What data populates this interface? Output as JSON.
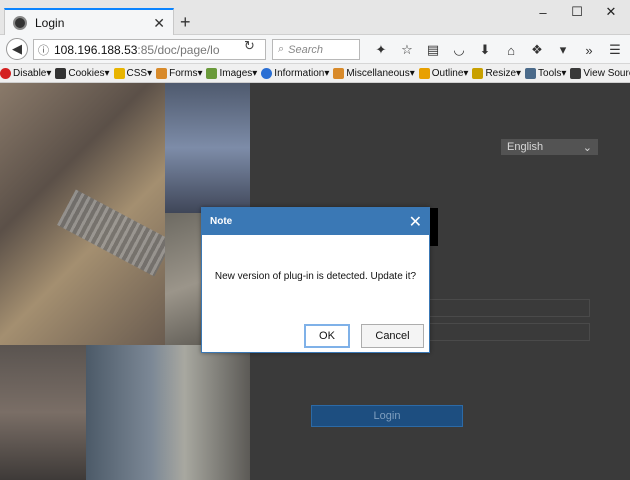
{
  "browser": {
    "tab_title": "Login",
    "tab_close": "✕",
    "new_tab": "+",
    "url_host": "108.196.188.53",
    "url_rest": ":85/doc/page/lo",
    "search_placeholder": "Search",
    "window_controls": [
      "–",
      "☐",
      "✕"
    ]
  },
  "devbar": {
    "items": [
      {
        "label": "Disable▾",
        "icon": "disable-icon",
        "color": "#d42020"
      },
      {
        "label": "Cookies▾",
        "icon": "cookie-icon",
        "color": "#333333"
      },
      {
        "label": "CSS▾",
        "icon": "css-icon",
        "color": "#e8b400"
      },
      {
        "label": "Forms▾",
        "icon": "forms-icon",
        "color": "#d88a2a"
      },
      {
        "label": "Images▾",
        "icon": "images-icon",
        "color": "#6a9a3a"
      },
      {
        "label": "Information▾",
        "icon": "info-icon",
        "color": "#2a6fd4"
      },
      {
        "label": "Miscellaneous▾",
        "icon": "misc-icon",
        "color": "#d88a2a"
      },
      {
        "label": "Outline▾",
        "icon": "outline-icon",
        "color": "#e8a000"
      },
      {
        "label": "Resize▾",
        "icon": "resize-icon",
        "color": "#c8a000"
      },
      {
        "label": "Tools▾",
        "icon": "tools-icon",
        "color": "#4a6a8a"
      },
      {
        "label": "View Source▾",
        "icon": "view-source-icon",
        "color": "#3a3a3a"
      }
    ]
  },
  "page": {
    "language": "English",
    "login_label": "Login"
  },
  "dialog": {
    "title": "Note",
    "close": "✕",
    "message": "New version of plug-in is detected. Update it?",
    "ok_label": "OK",
    "cancel_label": "Cancel"
  },
  "colors": {
    "dialog_header": "#3a78b5",
    "login_button": "#1d4e80"
  }
}
